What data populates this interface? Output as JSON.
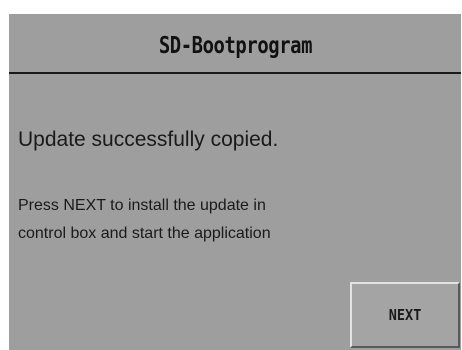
{
  "title_bar": {
    "title": "SD-Bootprogram"
  },
  "main": {
    "message": "Update successfully copied.",
    "instruction_lines": [
      "Press NEXT to install the update in",
      "control box and start the application"
    ]
  },
  "buttons": {
    "next_label": "NEXT"
  },
  "colors": {
    "screen_background": "#9e9e9e",
    "text": "#1a1a1a",
    "title_divider": "#1a1a1a"
  }
}
